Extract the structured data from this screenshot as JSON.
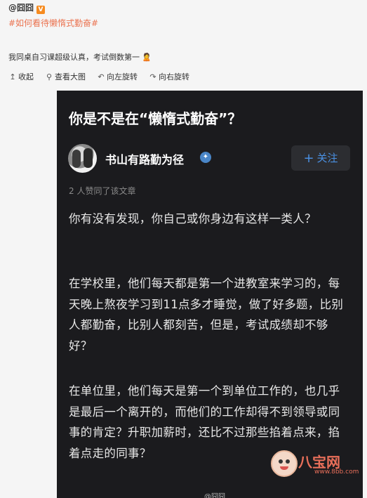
{
  "post": {
    "author": "@囧囧",
    "verified_badge": "V",
    "topic": "#如何看待懒惰式勤奋#",
    "text": "我同桌自习课超级认真，考试倒数第一",
    "emoji": "🙎"
  },
  "toolbar": {
    "collapse": "收起",
    "view_large": "查看大图",
    "rotate_left": "向左旋转",
    "rotate_right": "向右旋转"
  },
  "screenshot": {
    "question_title": "你是不是在“懒惰式勤奋”？",
    "user_name": "书山有路勤为径",
    "follow_label": "关注",
    "likes_text": "2 人赞同了该文章",
    "paragraphs": [
      "你有没有发现，你自己或你身边有这样一类人？",
      "在学校里，他们每天都是第一个进教室来学习的，每天晚上熬夜学习到11点多才睡觉，做了好多题，比别人都勤奋，比别人都刻苦，但是，考试成绩却不够好？",
      "在单位里，他们每天是第一个到单位工作的，也几乎是最后一个离开的，而他们的工作却得不到领导或同事的肯定？升职加薪时，还比不过那些掐着点来，掐着点走的同事？"
    ],
    "watermark": "@囧囧"
  },
  "site_watermark": {
    "name": "八宝网",
    "url": "www.8bb.com"
  },
  "colors": {
    "topic": "#eb7350",
    "screenshot_bg": "#1b1b1e",
    "follow_text": "#4a90e2",
    "watermark_text": "#e96f5a"
  }
}
